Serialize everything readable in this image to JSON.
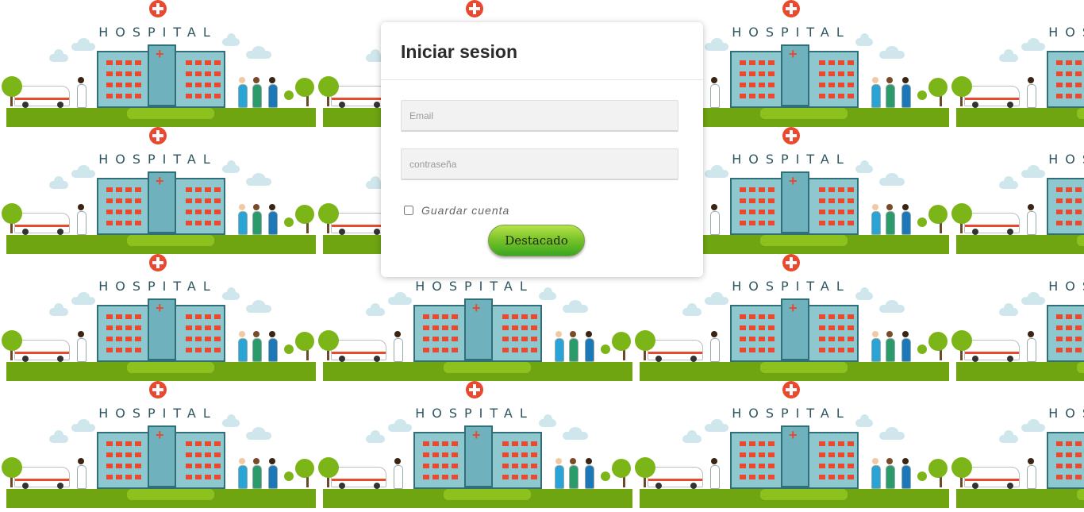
{
  "background": {
    "tile_word": "HOSPITAL",
    "colors": {
      "cross": "#e8492f",
      "ground": "#6ea511",
      "sky_cloud": "#cfe6ec",
      "building": "#8fc7cf"
    }
  },
  "login": {
    "title": "Iniciar sesion",
    "email_placeholder": "Email",
    "password_placeholder": "contraseña",
    "remember_label": "Guardar cuenta",
    "remember_checked": false,
    "submit_label": "Destacado",
    "button_color": "#6dbb2a"
  }
}
